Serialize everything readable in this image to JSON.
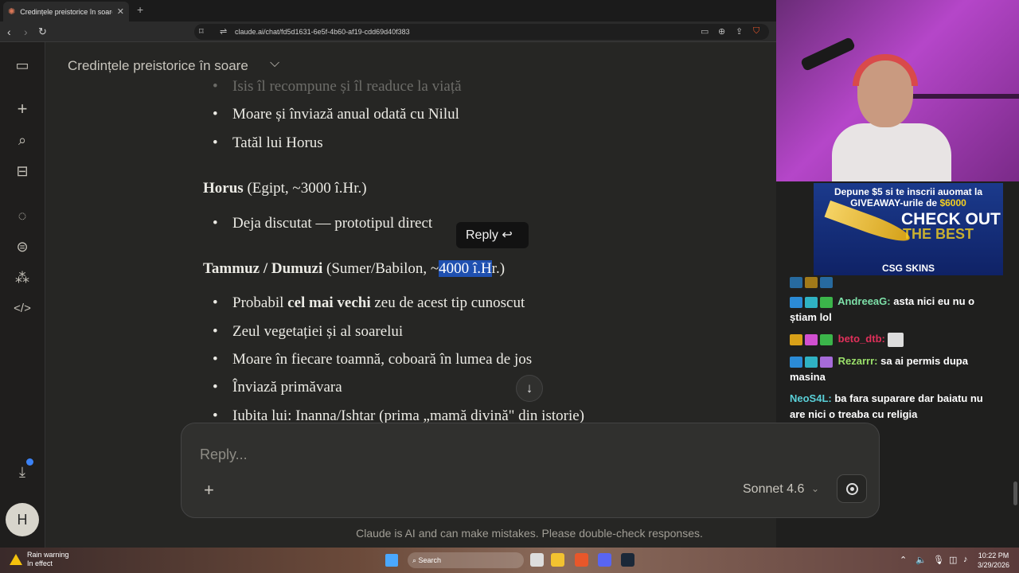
{
  "browser": {
    "tab_title": "Credințele preistorice în soare - Claude",
    "url": "claude.ai/chat/fd5d1631-6e5f-4b60-af19-cdd69d40f383"
  },
  "conversation": {
    "title": "Credințele preistorice în soare",
    "lines": {
      "isis_faded": "Isis îl recompune și îl readuce la viață",
      "osiris_b2": "Moare și înviază anual odată cu Nilul",
      "osiris_b3": "Tatăl lui Horus",
      "horus_name": "Horus",
      "horus_rest": "(Egipt, ~3000 î.Hr.)",
      "horus_b1": "Deja discutat — prototipul direct",
      "tammuz_name": "Tammuz / Dumuzi",
      "tammuz_pre": "(Sumer/Babilon, ~",
      "tammuz_hl": "4000 î.H",
      "tammuz_post": "r.)",
      "t_b1_a": "Probabil ",
      "t_b1_b": "cel mai vechi",
      "t_b1_c": " zeu de acest tip cunoscut",
      "t_b2": "Zeul vegetației și al soarelui",
      "t_b3": "Moare în fiecare toamnă, coboară în lumea de jos",
      "t_b4": "Înviază primăvara",
      "t_b5": "Iubita lui: Inanna/Ishtar (prima „mamă divină\" din istorie)"
    },
    "reply_tooltip": "Reply ↩"
  },
  "composer": {
    "placeholder": "Reply...",
    "model": "Sonnet 4.6",
    "disclaimer": "Claude is AI and can make mistakes. Please double-check responses."
  },
  "sidebar": {
    "avatar_initial": "H"
  },
  "stream": {
    "ad_line1": "Depune $5 si te inscrii auomat la",
    "ad_line2_a": "GIVEAWAY-urile de ",
    "ad_line2_b": "$6000",
    "ad_cta": "CHECK OUT",
    "ad_cta2": "THE BEST",
    "ad_brand": "CSG SKINS",
    "chat": [
      {
        "user": "AndreeaG:",
        "text": "asta nici eu nu o știam lol",
        "color": "#7de0a8"
      },
      {
        "user": "beto_dtb:",
        "text": "",
        "color": "#e0305a"
      },
      {
        "user": "Rezarrr:",
        "text": "sa ai permis dupa masina",
        "color": "#9ae06a"
      },
      {
        "user": "NeoS4L:",
        "text": "ba fara suparare dar baiatu nu are nici o treaba cu religia",
        "color": "#5ad0d8"
      }
    ]
  },
  "taskbar": {
    "weather_title": "Rain warning",
    "weather_sub": "In effect",
    "search": "Search",
    "time": "10:22 PM",
    "date": "3/29/2026"
  }
}
